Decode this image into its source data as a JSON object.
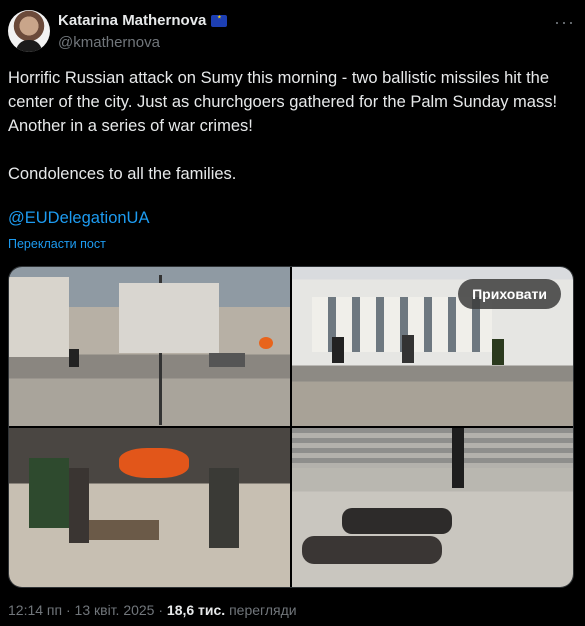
{
  "author": {
    "name": "Katarina Mathernova",
    "handle": "@kmathernova",
    "badge_icon": "eu-flag-icon"
  },
  "tweet": {
    "text": "Horrific Russian attack on Sumy this morning - two ballistic missiles hit the center of the city. Just as churchgoers gathered for the Palm Sunday mass! Another in a series of war crimes!\n\nCondolences to all the families.",
    "mention": "@EUDelegationUA",
    "translate_label": "Перекласти пост"
  },
  "media": {
    "hide_label": "Приховати",
    "photos": [
      "photo-1",
      "photo-2",
      "photo-3",
      "photo-4"
    ]
  },
  "meta": {
    "time": "12:14 пп",
    "date": "13 квіт. 2025",
    "separator": "·",
    "views_count": "18,6 тис.",
    "views_label": "перегляди"
  },
  "colors": {
    "link": "#1d9bf0",
    "muted": "#71767b",
    "text": "#e7e9ea",
    "background": "#000000"
  }
}
